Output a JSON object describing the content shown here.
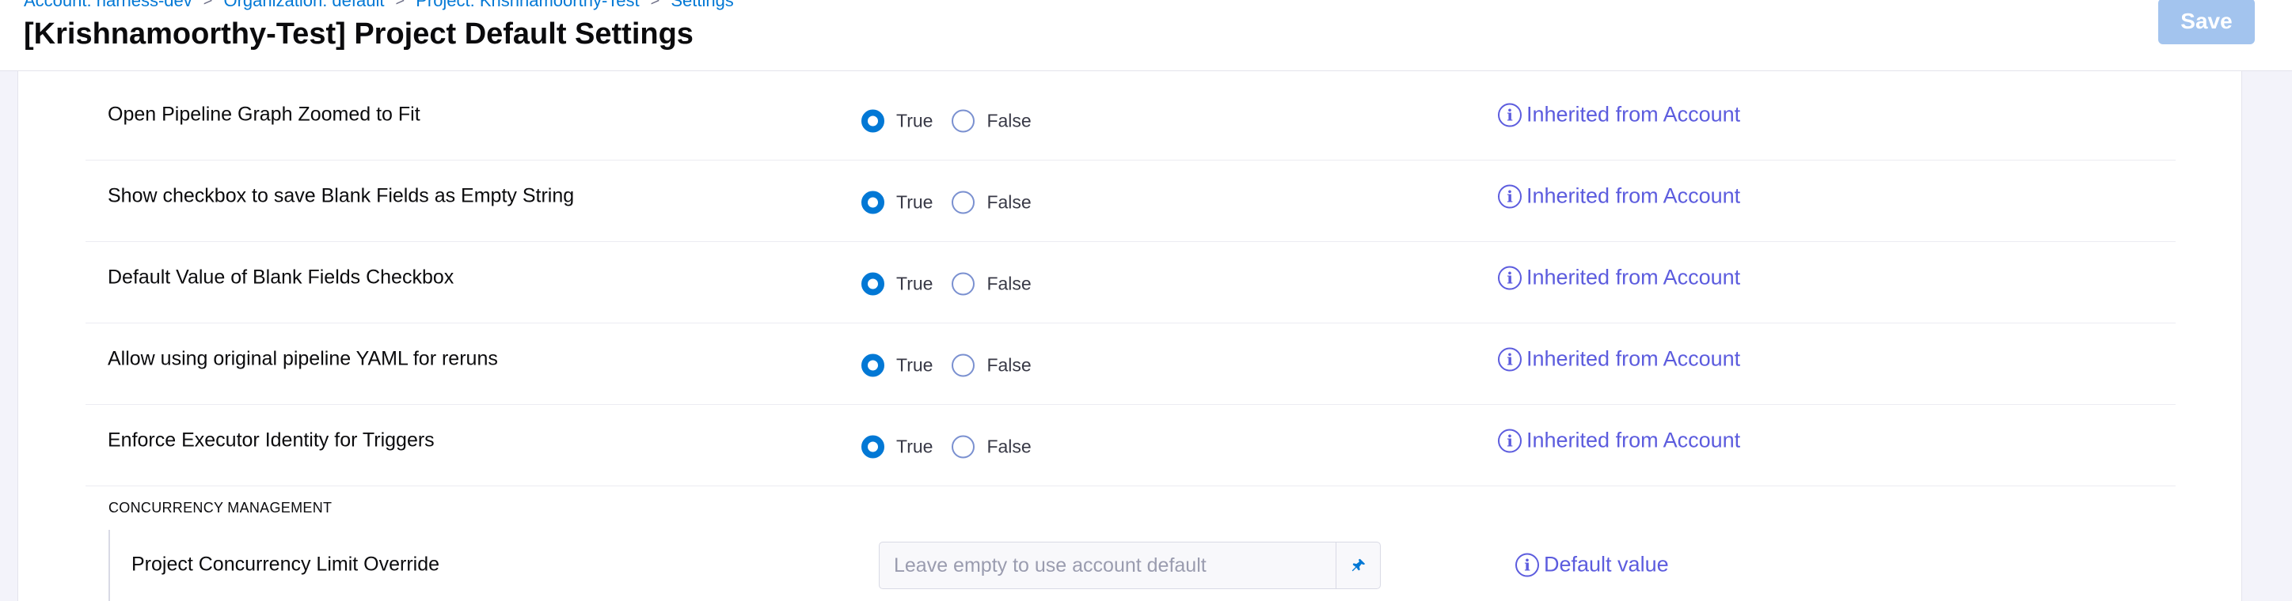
{
  "breadcrumb": {
    "account": "Account: harness-dev",
    "organization": "Organization: default",
    "project": "Project: Krishnamoorthy-Test",
    "current": "Settings",
    "separator": ">"
  },
  "page_title": "[Krishnamoorthy-Test] Project Default Settings",
  "save_label": "Save",
  "radio_labels": {
    "true": "True",
    "false": "False"
  },
  "settings": [
    {
      "label": "Open Pipeline Graph Zoomed to Fit",
      "value": "True",
      "source": "Inherited from Account"
    },
    {
      "label": "Show checkbox to save Blank Fields as Empty String",
      "value": "True",
      "source": "Inherited from Account"
    },
    {
      "label": "Default Value of Blank Fields Checkbox",
      "value": "True",
      "source": "Inherited from Account"
    },
    {
      "label": "Allow using original pipeline YAML for reruns",
      "value": "True",
      "source": "Inherited from Account"
    },
    {
      "label": "Enforce Executor Identity for Triggers",
      "value": "True",
      "source": "Inherited from Account"
    }
  ],
  "concurrency": {
    "section_title": "CONCURRENCY MANAGEMENT",
    "label": "Project Concurrency Limit Override",
    "value": "",
    "placeholder": "Leave empty to use account default",
    "source": "Default value"
  },
  "colors": {
    "accent": "#0278d5",
    "link": "#5c5cde",
    "save_disabled": "#a3c4ee"
  },
  "icons": {
    "info": "info-circle-icon",
    "pin": "pin-icon",
    "chevron": "chevron-right-icon"
  }
}
